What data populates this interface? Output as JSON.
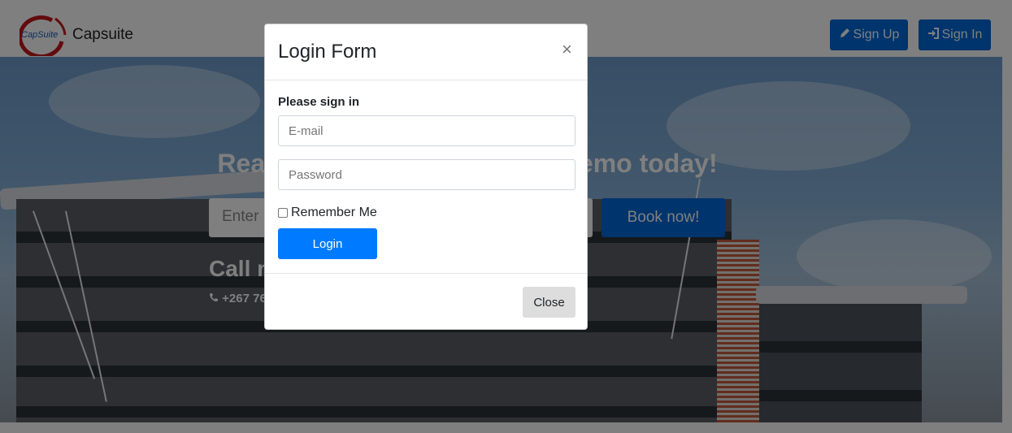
{
  "navbar": {
    "brand_logo_text": "CapSuite",
    "brand_name": "Capsuite",
    "signup_label": "Sign Up",
    "signin_label": "Sign In",
    "signup_icon": "pencil-icon",
    "signin_icon": "sign-in-icon"
  },
  "hero": {
    "title": "Ready to get started? Book demo today!",
    "input_placeholder": "Enter",
    "book_label": "Book now!",
    "call_title": "Call now",
    "phone": "+267 76",
    "phone_icon": "phone-icon"
  },
  "modal": {
    "title": "Login Form",
    "close_symbol": "×",
    "prompt": "Please sign in",
    "email_placeholder": "E-mail",
    "password_placeholder": "Password",
    "remember_label": "Remember Me",
    "login_label": "Login",
    "close_label": "Close"
  },
  "colors": {
    "primary_button": "#007bff",
    "nav_button": "#0069d9",
    "close_button": "#dddddd",
    "backdrop": "rgba(0,0,0,0.5)"
  }
}
